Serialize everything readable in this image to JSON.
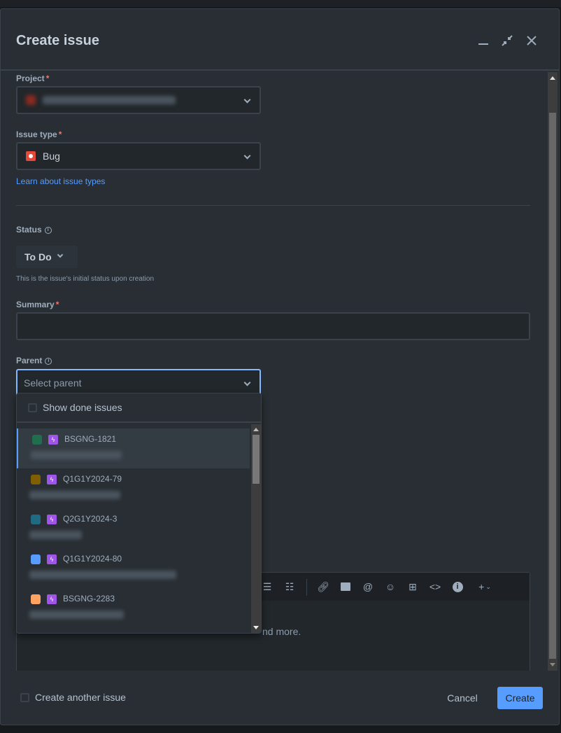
{
  "modal": {
    "title": "Create issue",
    "header_buttons": [
      "minimize-icon",
      "collapse-icon",
      "close-icon"
    ]
  },
  "fields": {
    "project": {
      "label": "Project",
      "required": "*",
      "value": "Project name (blurred)",
      "icon_color": "#8b2a20"
    },
    "issue_type": {
      "label": "Issue type",
      "required": "*",
      "value": "Bug",
      "icon_color": "#e5493a",
      "link": "Learn about issue types"
    },
    "status": {
      "label": "Status",
      "value": "To Do",
      "hint": "This is the issue's initial status upon creation"
    },
    "summary": {
      "label": "Summary",
      "required": "*",
      "value": ""
    },
    "parent": {
      "label": "Parent",
      "placeholder": "Select parent"
    },
    "description": {
      "placeholder_tail": "nd more."
    }
  },
  "parent_dropdown": {
    "show_done_label": "Show done issues",
    "items": [
      {
        "key": "BSGNG-1821",
        "color": "#216e4e",
        "summary": "(blurred)",
        "active": true
      },
      {
        "key": "Q1G1Y2024-79",
        "color": "#7f5f01",
        "summary": "(blurred)",
        "active": false
      },
      {
        "key": "Q2G1Y2024-3",
        "color": "#206a83",
        "summary": "(blurred)",
        "active": false
      },
      {
        "key": "Q1G1Y2024-80",
        "color": "#579dff",
        "summary": "(blurred)",
        "active": false
      },
      {
        "key": "BSGNG-2283",
        "color": "#fea362",
        "summary": "(blurred)",
        "active": false
      }
    ]
  },
  "footer": {
    "create_another": "Create another issue",
    "cancel": "Cancel",
    "create": "Create"
  },
  "colors": {
    "accent": "#579dff",
    "epic": "#9f55e8",
    "required": "#f87168"
  }
}
